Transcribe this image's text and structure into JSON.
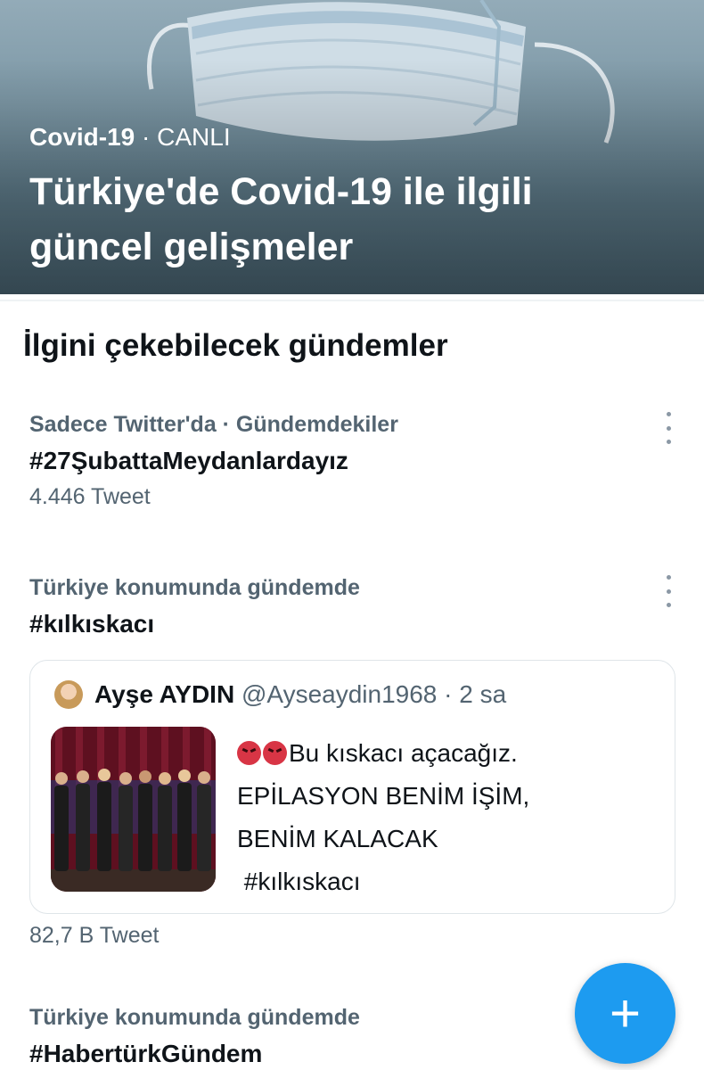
{
  "hero": {
    "category": "Covid-19",
    "separator": "·",
    "status": "CANLI",
    "title": "Türkiye'de Covid-19 ile ilgili güncel gelişmeler"
  },
  "section": {
    "title": "İlgini çekebilecek gündemler"
  },
  "trends": [
    {
      "context": "Sadece Twitter'da · Gündemdekiler",
      "name": "#27ŞubattaMeydanlardayız",
      "count": "4.446 Tweet"
    },
    {
      "context": "Türkiye konumunda gündemde",
      "name": "#kılkıskacı",
      "count": "82,7 B Tweet",
      "tweet": {
        "display_name": "Ayşe AYDIN",
        "username": "@Ayseaydin1968",
        "separator": "·",
        "time": "2 sa",
        "line1": "Bu kıskacı açacağız.",
        "line2": "EPİLASYON BENİM İŞİM,",
        "line3": "BENİM KALACAK",
        "line4": " #kılkıskacı",
        "emoji": "angry-face-icon"
      }
    },
    {
      "context": "Türkiye konumunda gündemde",
      "name": "#HabertürkGündem"
    }
  ],
  "compose": {
    "icon": "plus-icon",
    "symbol": "+"
  },
  "colors": {
    "accent": "#1d9bf0",
    "text": "#0f1419",
    "secondary": "#536471",
    "border": "#dfe5e9"
  }
}
